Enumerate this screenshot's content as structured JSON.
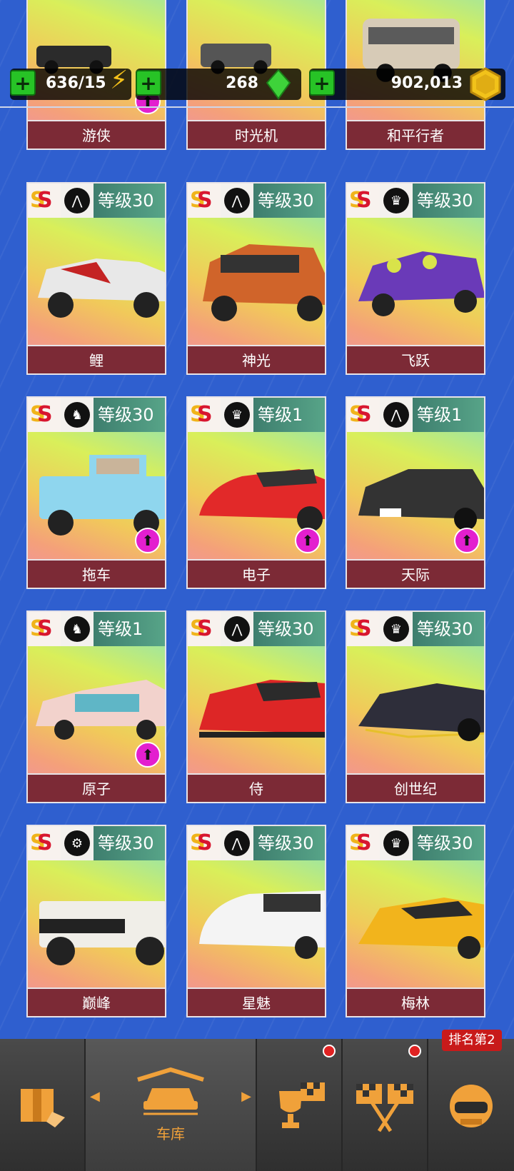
{
  "resources": {
    "energy": "636/15",
    "gems": "268",
    "coins": "902,013"
  },
  "cards": [
    {
      "name": "游侠",
      "level": "",
      "class_icon": "",
      "upgrade": true,
      "car_color": "#2b2b2b"
    },
    {
      "name": "时光机",
      "level": "",
      "class_icon": "",
      "upgrade": false,
      "car_color": "#555555"
    },
    {
      "name": "和平行者",
      "level": "",
      "class_icon": "",
      "upgrade": false,
      "car_color": "#d7cbb7"
    },
    {
      "name": "鲤",
      "level": "等级30",
      "class_icon": "road-icon",
      "upgrade": false,
      "car_color": "#e8e8e8"
    },
    {
      "name": "神光",
      "level": "等级30",
      "class_icon": "road-icon",
      "upgrade": false,
      "car_color": "#d0642a"
    },
    {
      "name": "飞跃",
      "level": "等级30",
      "class_icon": "crown-icon",
      "upgrade": false,
      "car_color": "#6a3ab8"
    },
    {
      "name": "拖车",
      "level": "等级30",
      "class_icon": "horse-icon",
      "upgrade": true,
      "car_color": "#8fd6ee"
    },
    {
      "name": "电子",
      "level": "等级1",
      "class_icon": "crown-icon",
      "upgrade": true,
      "car_color": "#e22929"
    },
    {
      "name": "天际",
      "level": "等级1",
      "class_icon": "road-icon",
      "upgrade": true,
      "car_color": "#333333"
    },
    {
      "name": "原子",
      "level": "等级1",
      "class_icon": "horse-icon",
      "upgrade": true,
      "car_color": "#f2d2cc"
    },
    {
      "name": "侍",
      "level": "等级30",
      "class_icon": "road-icon",
      "upgrade": false,
      "car_color": "#dd2626"
    },
    {
      "name": "创世纪",
      "level": "等级30",
      "class_icon": "crown-icon",
      "upgrade": false,
      "car_color": "#2e2e3a"
    },
    {
      "name": "巅峰",
      "level": "等级30",
      "class_icon": "wheel-icon",
      "upgrade": false,
      "car_color": "#f0eee8"
    },
    {
      "name": "星魅",
      "level": "等级30",
      "class_icon": "road-icon",
      "upgrade": false,
      "car_color": "#f4f4f4"
    },
    {
      "name": "梅林",
      "level": "等级30",
      "class_icon": "crown-icon",
      "upgrade": false,
      "car_color": "#f2b41c"
    }
  ],
  "nav": {
    "garage_label": "车库",
    "rank_badge": "排名第2"
  },
  "colors": {
    "background": "#2f5fcf",
    "name_bar": "#7c2a36",
    "level_bar": "#4c927c",
    "upgrade_badge": "#e31fcf",
    "nav_accent": "#f0a13a"
  }
}
